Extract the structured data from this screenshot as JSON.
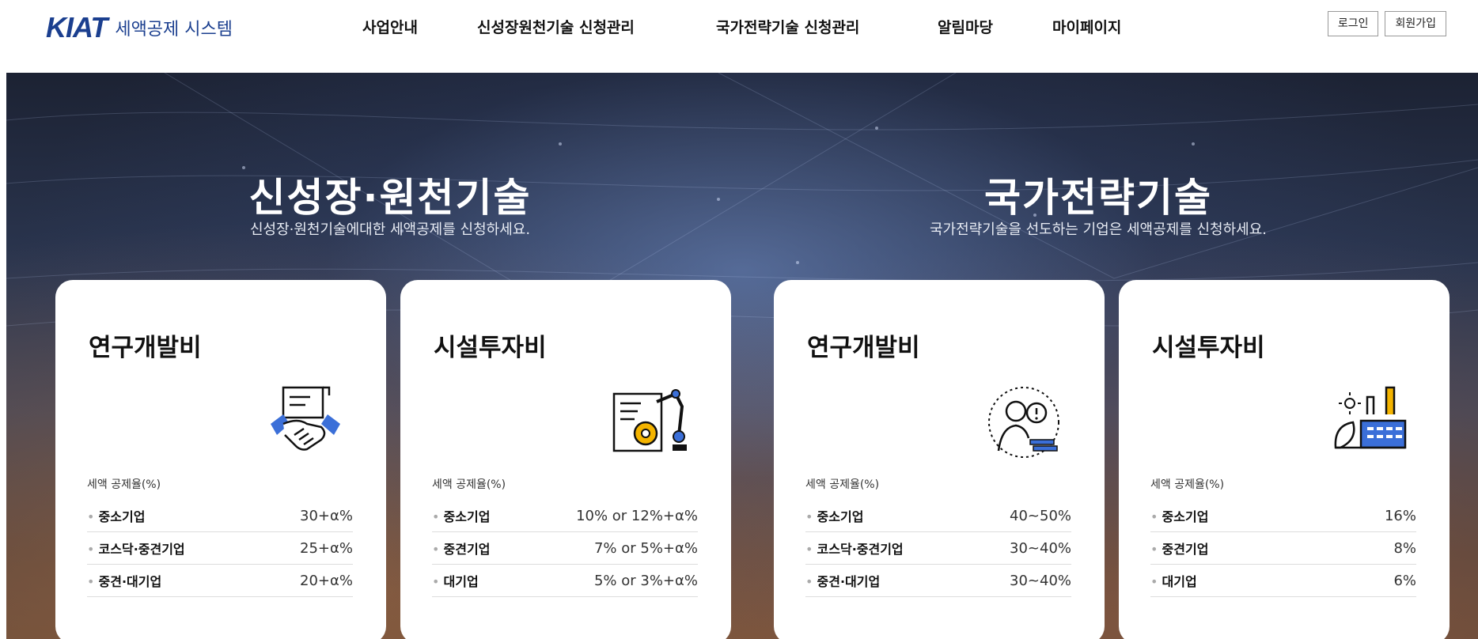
{
  "header": {
    "logo_mark": "KIAT",
    "logo_sub": "세액공제 시스템",
    "nav": [
      "사업안내",
      "신성장원천기술 신청관리",
      "국가전략기술 신청관리",
      "알림마당",
      "마이페이지"
    ],
    "login_label": "로그인",
    "signup_label": "회원가입"
  },
  "sections": [
    {
      "title": "신성장·원천기술",
      "subtitle": "신성장·원천기술에대한 세액공제를 신청하세요."
    },
    {
      "title": "국가전략기술",
      "subtitle": "국가전략기술을 선도하는 기업은 세액공제를 신청하세요."
    }
  ],
  "cards": [
    {
      "title": "연구개발비",
      "icon": "handshake-contract-icon",
      "rate_label": "세액 공제율(%)",
      "rows": [
        {
          "label": "중소기업",
          "value": "30+α%"
        },
        {
          "label": "코스닥·중견기업",
          "value": "25+α%"
        },
        {
          "label": "중견·대기업",
          "value": "20+α%"
        }
      ]
    },
    {
      "title": "시설투자비",
      "icon": "robot-arm-gear-icon",
      "rate_label": "세액 공제율(%)",
      "rows": [
        {
          "label": "중소기업",
          "value": "10% or 12%+α%"
        },
        {
          "label": "중견기업",
          "value": "7% or 5%+α%"
        },
        {
          "label": "대기업",
          "value": "5% or 3%+α%"
        }
      ]
    },
    {
      "title": "연구개발비",
      "icon": "researcher-idea-icon",
      "rate_label": "세액 공제율(%)",
      "rows": [
        {
          "label": "중소기업",
          "value": "40~50%"
        },
        {
          "label": "코스닥·중견기업",
          "value": "30~40%"
        },
        {
          "label": "중견·대기업",
          "value": "30~40%"
        }
      ]
    },
    {
      "title": "시설투자비",
      "icon": "factory-plant-icon",
      "rate_label": "세액 공제율(%)",
      "rows": [
        {
          "label": "중소기업",
          "value": "16%"
        },
        {
          "label": "중견기업",
          "value": "8%"
        },
        {
          "label": "대기업",
          "value": "6%"
        }
      ]
    }
  ],
  "colors": {
    "brand": "#1b3f8f",
    "icon_accent": "#3b6fd8",
    "icon_yellow": "#f4b400"
  }
}
